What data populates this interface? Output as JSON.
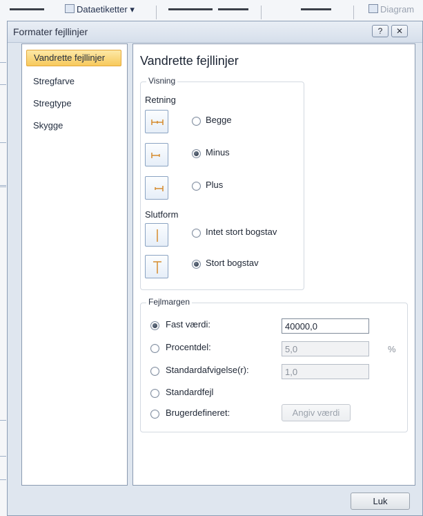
{
  "app": {
    "data_labels": "Dataetiketter ▾",
    "diagram": "Diagram"
  },
  "dialog": {
    "title": "Formater fejllinjer",
    "help_glyph": "?",
    "close_glyph": "✕"
  },
  "nav": {
    "items": [
      {
        "label": "Vandrette fejllinjer",
        "active": true
      },
      {
        "label": "Stregfarve",
        "active": false
      },
      {
        "label": "Stregtype",
        "active": false
      },
      {
        "label": "Skygge",
        "active": false
      }
    ]
  },
  "panel": {
    "title": "Vandrette fejllinjer",
    "visning": {
      "title": "Visning",
      "retning_label": "Retning",
      "options": [
        {
          "label": "Begge",
          "checked": false,
          "icon": "error-bar-both-icon"
        },
        {
          "label": "Minus",
          "checked": true,
          "icon": "error-bar-minus-icon"
        },
        {
          "label": "Plus",
          "checked": false,
          "icon": "error-bar-plus-icon"
        }
      ],
      "slutform_label": "Slutform",
      "end_options": [
        {
          "label": "Intet stort bogstav",
          "checked": false,
          "icon": "no-cap-icon"
        },
        {
          "label": "Stort bogstav",
          "checked": true,
          "icon": "cap-icon"
        }
      ]
    },
    "fejlmargen": {
      "title": "Fejlmargen",
      "fixed_label": "Fast værdi:",
      "fixed_value": "40000,0",
      "percent_label": "Procentdel:",
      "percent_value": "5,0",
      "percent_unit": "%",
      "stddev_label": "Standardafvigelse(r):",
      "stddev_value": "1,0",
      "stderr_label": "Standardfejl",
      "custom_label": "Brugerdefineret:",
      "specify_button": "Angiv værdi",
      "selected": "fixed"
    }
  },
  "footer": {
    "close_button": "Luk"
  },
  "colors": {
    "accent_orange": "#d58a2c",
    "nav_active_bg": "#f7c95c",
    "dialog_bg": "#dfe6ef"
  }
}
